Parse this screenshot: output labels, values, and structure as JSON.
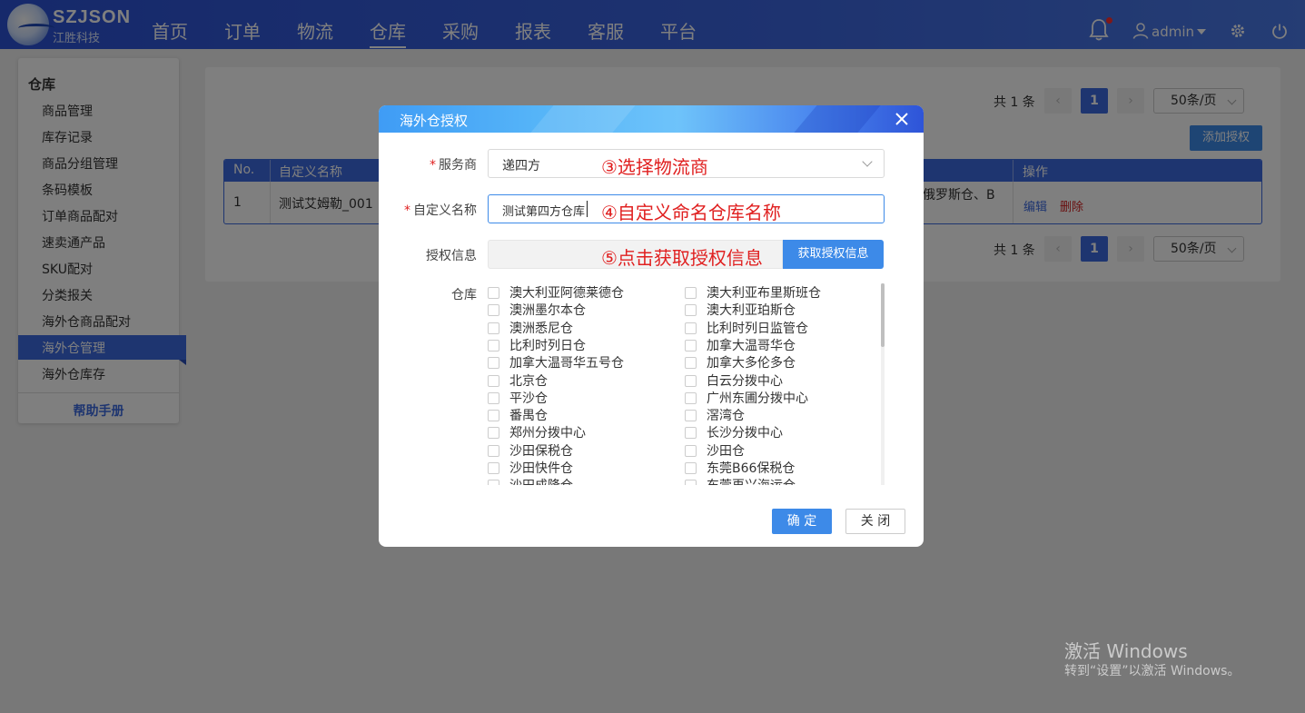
{
  "brand": {
    "name": "SZJSON",
    "subtitle": "江胜科技"
  },
  "topnav": {
    "items": [
      {
        "label": "首页"
      },
      {
        "label": "订单"
      },
      {
        "label": "物流"
      },
      {
        "label": "仓库",
        "active": true
      },
      {
        "label": "采购"
      },
      {
        "label": "报表"
      },
      {
        "label": "客服"
      },
      {
        "label": "平台"
      }
    ],
    "user": "admin"
  },
  "sidebar": {
    "title": "仓库",
    "items": [
      {
        "label": "商品管理"
      },
      {
        "label": "库存记录"
      },
      {
        "label": "商品分组管理"
      },
      {
        "label": "条码模板"
      },
      {
        "label": "订单商品配对"
      },
      {
        "label": "速卖通产品"
      },
      {
        "label": "SKU配对"
      },
      {
        "label": "分类报关"
      },
      {
        "label": "海外仓商品配对"
      },
      {
        "label": "海外仓管理",
        "active": true
      },
      {
        "label": "海外仓库存"
      }
    ],
    "help": "帮助手册"
  },
  "main": {
    "pagination": {
      "total": "共 1 条",
      "current": "1",
      "page_size": "50条/页"
    },
    "add_button": "添加授权",
    "table": {
      "headers": [
        "No.",
        "自定义名称",
        "操作"
      ],
      "rows": [
        {
          "no": "1",
          "name": "测试艾姆勒_001",
          "warehouses": "俄罗斯仓、B",
          "edit": "编辑",
          "delete": "删除"
        }
      ]
    }
  },
  "modal": {
    "title": "海外仓授权",
    "fields": {
      "provider": {
        "label": "服务商",
        "value": "递四方"
      },
      "custom_name": {
        "label": "自定义名称",
        "value": "测试第四方仓库"
      },
      "auth_info": {
        "label": "授权信息",
        "button": "获取授权信息"
      },
      "warehouse": {
        "label": "仓库"
      }
    },
    "annotations": {
      "step3": "③选择物流商",
      "step4": "④自定义命名仓库名称",
      "step5": "⑤点击获取授权信息"
    },
    "warehouses_left": [
      "澳大利亚阿德莱德仓",
      "澳洲墨尔本仓",
      "澳洲悉尼仓",
      "比利时列日仓",
      "加拿大温哥华五号仓",
      "北京仓",
      "平沙仓",
      "番禺仓",
      "郑州分拨中心",
      "沙田保税仓",
      "沙田快件仓",
      "沙田成隆仓"
    ],
    "warehouses_right": [
      "澳大利亚布里斯班仓",
      "澳大利亚珀斯仓",
      "比利时列日监管仓",
      "加拿大温哥华仓",
      "加拿大多伦多仓",
      "白云分拨中心",
      "广州东圃分拨中心",
      "滘湾仓",
      "长沙分拨中心",
      "沙田仓",
      "东莞B66保税仓",
      "东莞再兴海运仓"
    ],
    "ok": "确 定",
    "close": "关 闭"
  },
  "watermark": {
    "line1": "激活 Windows",
    "line2": "转到“设置”以激活 Windows。"
  }
}
